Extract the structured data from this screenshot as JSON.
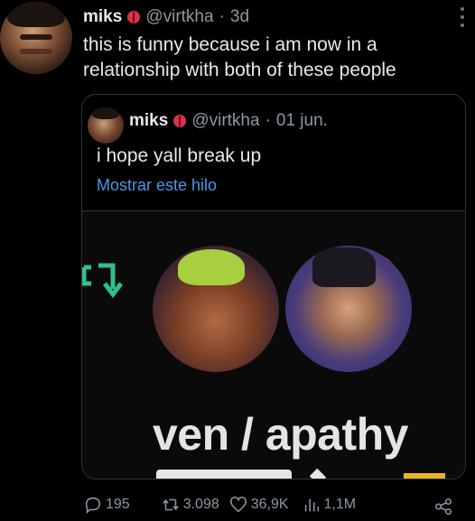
{
  "tweet": {
    "name": "miks",
    "handle": "@virtkha",
    "separator": "·",
    "time": "3d",
    "text": "this is funny because i am now in a relationship with both of these people"
  },
  "quote": {
    "name": "miks",
    "handle": "@virtkha",
    "separator": "·",
    "time": "01 jun.",
    "text": "i hope yall break up",
    "show_thread": "Mostrar este hilo",
    "media_title": "ven / apathy"
  },
  "actions": {
    "replies": "195",
    "retweets": "3.098",
    "likes": "36,9K",
    "views": "1,1M"
  },
  "colors": {
    "link": "#4a99e9",
    "muted": "#8b98a5",
    "badge": "#d8344a",
    "arrow": "#2ec28b"
  }
}
